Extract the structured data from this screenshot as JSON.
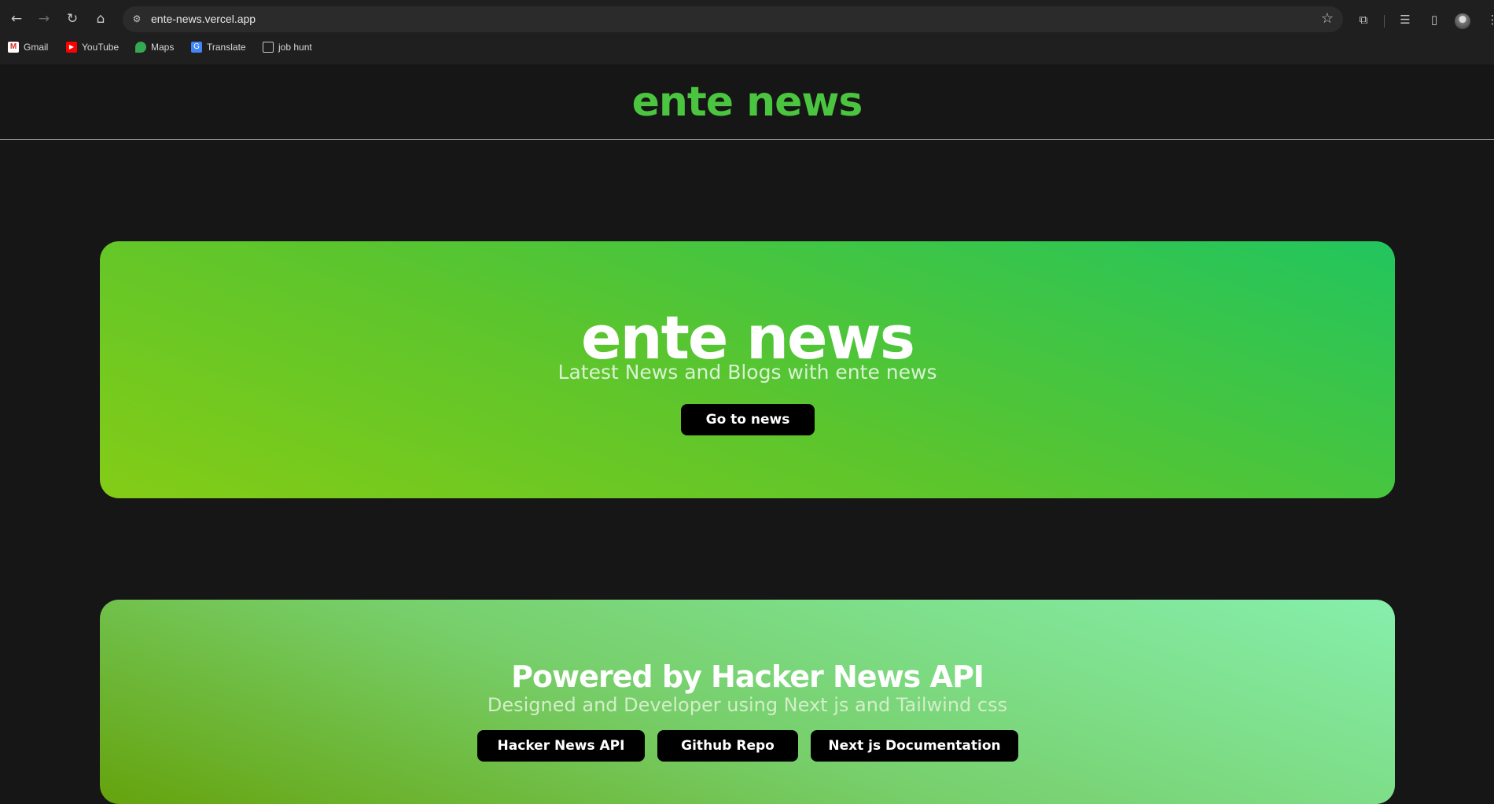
{
  "browser": {
    "url": "ente-news.vercel.app",
    "bookmarks": [
      "Gmail",
      "YouTube",
      "Maps",
      "Translate",
      "job hunt"
    ],
    "icons": [
      "back-icon",
      "forward-icon",
      "reload-icon",
      "home-icon",
      "site-settings-icon",
      "star-icon",
      "extensions-icon",
      "reading-list-icon",
      "side-panel-icon",
      "profile-avatar",
      "menu-icon"
    ]
  },
  "header": {
    "title": "ente news",
    "title_color": "#4bc53f"
  },
  "hero": {
    "title": "ente news",
    "subtitle": "Latest News and Blogs with ente news",
    "button": "Go to news",
    "gradient": [
      "#84cc16",
      "#22c55e"
    ]
  },
  "powered": {
    "title": "Powered by Hacker News API",
    "subtitle": "Designed and Developer using Next js and Tailwind css",
    "buttons": [
      "Hacker News API",
      "Github Repo",
      "Next js Documentation"
    ],
    "gradient": [
      "#65a30d",
      "#86efac"
    ]
  }
}
